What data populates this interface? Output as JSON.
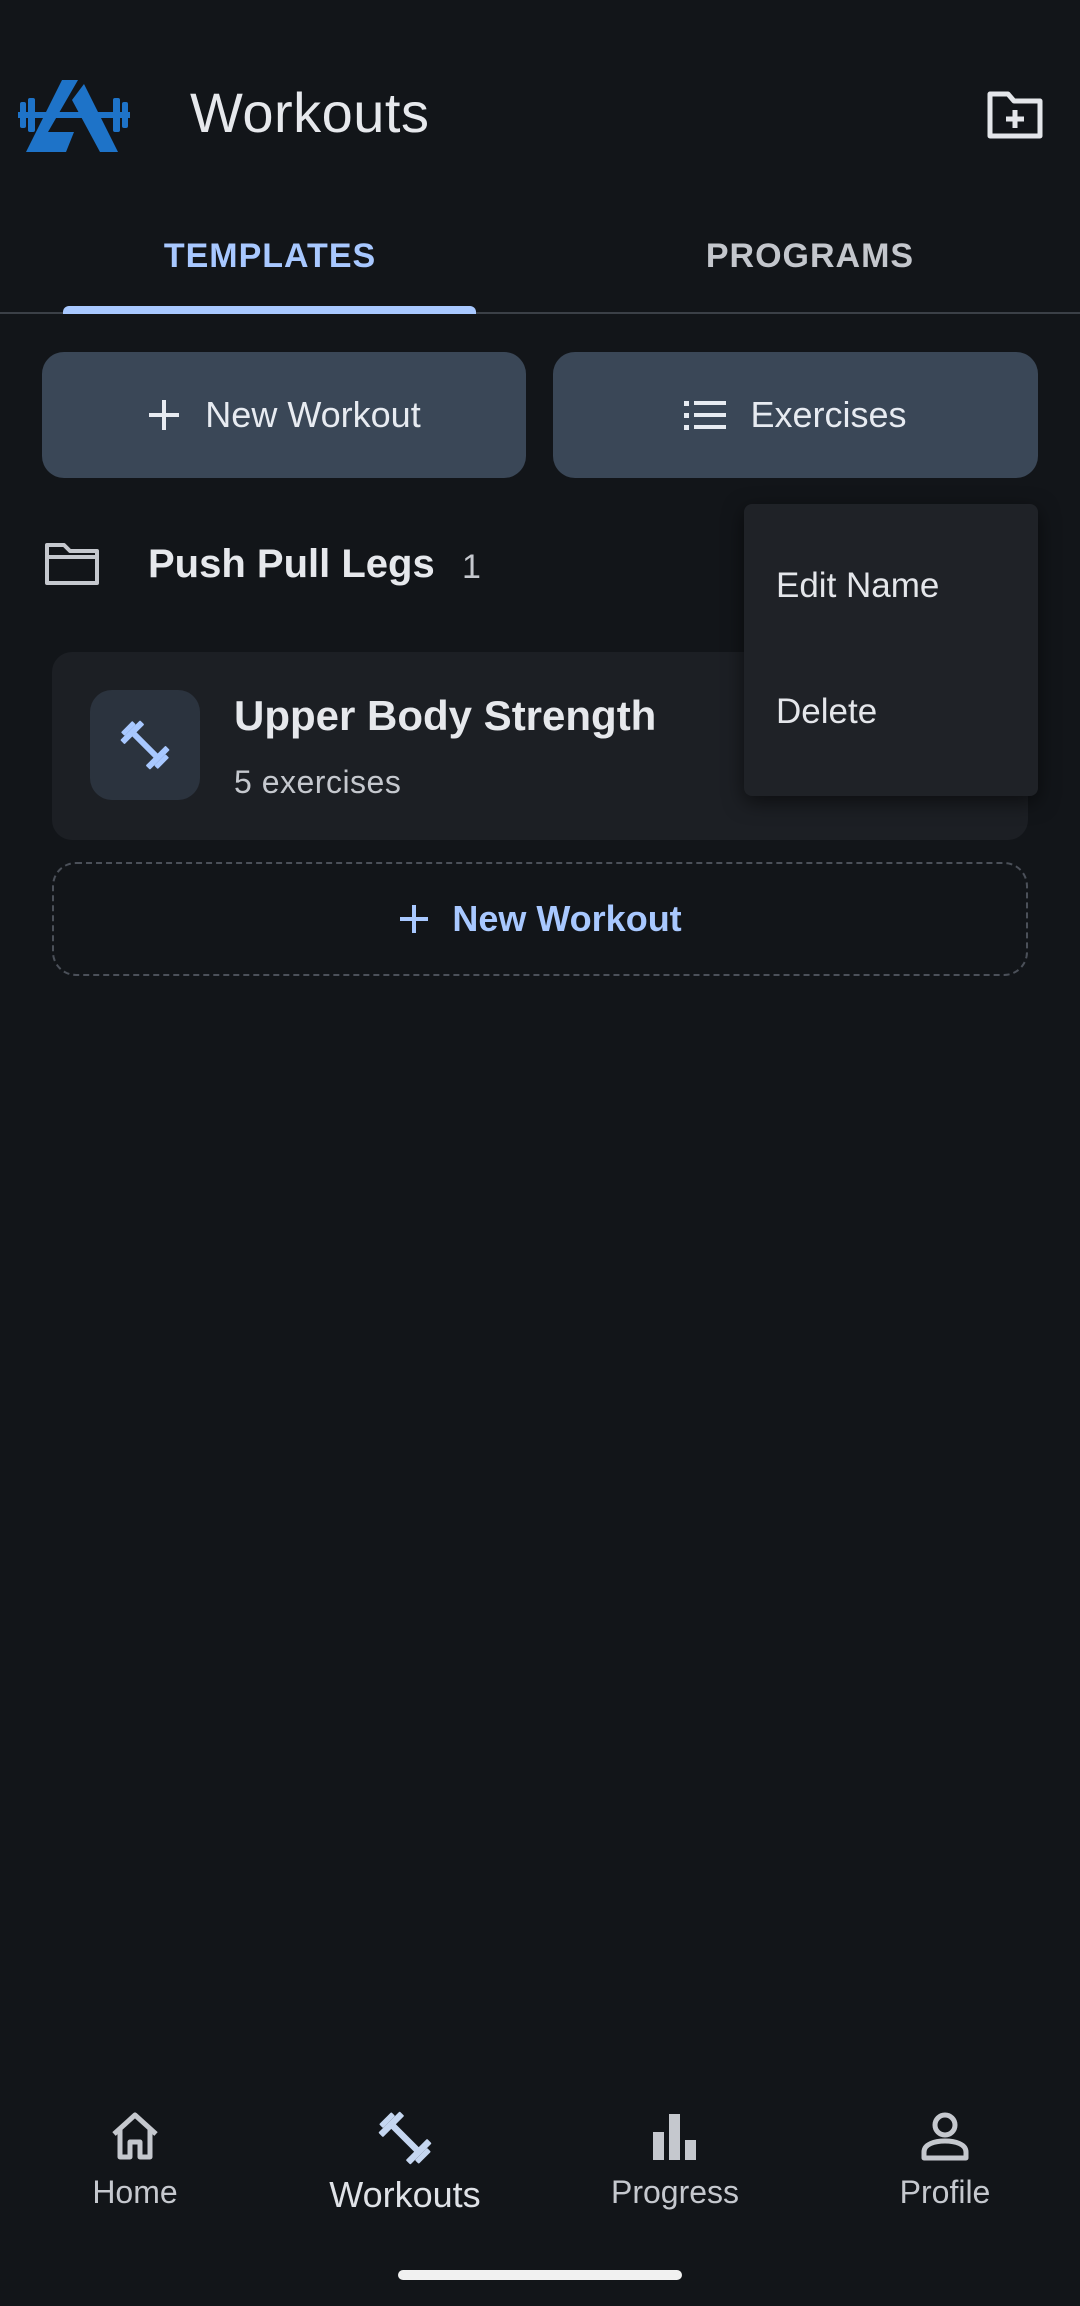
{
  "header": {
    "title": "Workouts",
    "logo_icon": "barbell-triangle-logo",
    "new_folder_icon": "folder-plus-icon"
  },
  "tabs": [
    {
      "label": "TEMPLATES",
      "active": true
    },
    {
      "label": "PROGRAMS",
      "active": false
    }
  ],
  "actions": {
    "new_workout_label": "New Workout",
    "exercises_label": "Exercises"
  },
  "folder": {
    "name": "Push Pull Legs",
    "count": "1"
  },
  "workouts": [
    {
      "name": "Upper Body Strength",
      "subtitle": "5 exercises",
      "icon": "dumbbell-icon"
    }
  ],
  "add_workout_label": "New Workout",
  "menu": {
    "items": [
      "Edit Name",
      "Delete"
    ]
  },
  "bottom_nav": [
    {
      "label": "Home",
      "icon": "home-icon",
      "active": false
    },
    {
      "label": "Workouts",
      "icon": "dumbbell-icon",
      "active": true
    },
    {
      "label": "Progress",
      "icon": "bar-chart-icon",
      "active": false
    },
    {
      "label": "Profile",
      "icon": "person-icon",
      "active": false
    }
  ],
  "colors": {
    "background": "#121519",
    "accent": "#a8c8ff",
    "button_bg": "#3a4757",
    "card_bg": "#1c1f24",
    "logo_blue": "#1e73c8"
  }
}
